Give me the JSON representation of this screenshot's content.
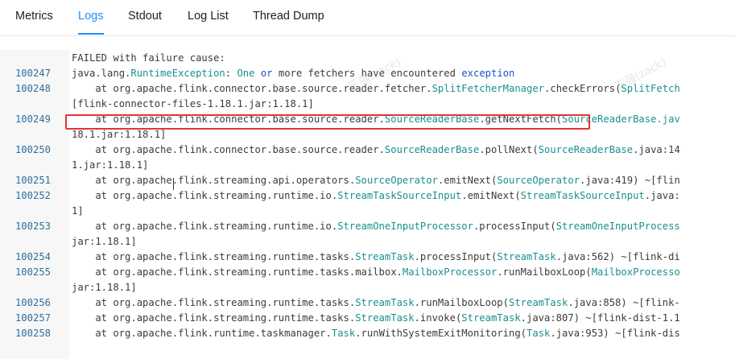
{
  "tabs": [
    {
      "label": "Metrics",
      "active": false
    },
    {
      "label": "Logs",
      "active": true
    },
    {
      "label": "Stdout",
      "active": false
    },
    {
      "label": "Log List",
      "active": false
    },
    {
      "label": "Thread Dump",
      "active": false
    }
  ],
  "colors": {
    "accent": "#1890ff",
    "highlight_border": "#e23434",
    "type_name": "#1a8f8f",
    "keyword": "#1a52c4",
    "line_number": "#2e6f9e"
  },
  "log": {
    "lines": [
      {
        "ln": "",
        "segs": [
          {
            "t": "FAILED with failure cause:",
            "c": ""
          }
        ]
      },
      {
        "ln": "100247",
        "segs": [
          {
            "t": "java.lang.",
            "c": ""
          },
          {
            "t": "RuntimeException",
            "c": "t1"
          },
          {
            "t": ": ",
            "c": ""
          },
          {
            "t": "One",
            "c": "t1"
          },
          {
            "t": " ",
            "c": ""
          },
          {
            "t": "or",
            "c": "t2"
          },
          {
            "t": " more fetchers have encountered ",
            "c": ""
          },
          {
            "t": "exception",
            "c": "t2"
          }
        ]
      },
      {
        "ln": "100248",
        "segs": [
          {
            "t": "    at org.apache.flink.connector.base.source.reader.fetcher.",
            "c": ""
          },
          {
            "t": "SplitFetcherManager",
            "c": "t1"
          },
          {
            "t": ".checkErrors(",
            "c": ""
          },
          {
            "t": "SplitFetch",
            "c": "t1"
          }
        ]
      },
      {
        "ln": "",
        "segs": [
          {
            "t": "[flink-connector-files-1.18.1.jar:1.18.1]",
            "c": ""
          }
        ]
      },
      {
        "ln": "100249",
        "segs": [
          {
            "t": "    at org.apache.flink.connector.base.source.reader.",
            "c": ""
          },
          {
            "t": "SourceReaderBase",
            "c": "t1"
          },
          {
            "t": ".getNextFetch(",
            "c": ""
          },
          {
            "t": "SourceReaderBase.jav",
            "c": "t1"
          }
        ]
      },
      {
        "ln": "",
        "segs": [
          {
            "t": "18.1.jar:1.18.1]",
            "c": ""
          }
        ]
      },
      {
        "ln": "100250",
        "segs": [
          {
            "t": "    at org.apache.flink.connector.base.source.reader.",
            "c": ""
          },
          {
            "t": "SourceReaderBase",
            "c": "t1"
          },
          {
            "t": ".pollNext(",
            "c": ""
          },
          {
            "t": "SourceReaderBase",
            "c": "t1"
          },
          {
            "t": ".java:14",
            "c": ""
          }
        ]
      },
      {
        "ln": "",
        "segs": [
          {
            "t": "1.jar:1.18.1]",
            "c": ""
          }
        ]
      },
      {
        "ln": "100251",
        "segs": [
          {
            "t": "    at org.apache.flink.streaming.api.operators.",
            "c": ""
          },
          {
            "t": "SourceOperator",
            "c": "t1"
          },
          {
            "t": ".emitNext(",
            "c": ""
          },
          {
            "t": "SourceOperator",
            "c": "t1"
          },
          {
            "t": ".java:419) ~[flin",
            "c": ""
          }
        ]
      },
      {
        "ln": "100252",
        "segs": [
          {
            "t": "    at org.apache.flink.streaming.runtime.io.",
            "c": ""
          },
          {
            "t": "StreamTaskSourceInput",
            "c": "t1"
          },
          {
            "t": ".emitNext(",
            "c": ""
          },
          {
            "t": "StreamTaskSourceInput",
            "c": "t1"
          },
          {
            "t": ".java:",
            "c": ""
          }
        ]
      },
      {
        "ln": "",
        "segs": [
          {
            "t": "1]",
            "c": ""
          }
        ]
      },
      {
        "ln": "100253",
        "segs": [
          {
            "t": "    at org.apache.flink.streaming.runtime.io.",
            "c": ""
          },
          {
            "t": "StreamOneInputProcessor",
            "c": "t1"
          },
          {
            "t": ".processInput(",
            "c": ""
          },
          {
            "t": "StreamOneInputProcess",
            "c": "t1"
          }
        ]
      },
      {
        "ln": "",
        "segs": [
          {
            "t": "jar:1.18.1]",
            "c": ""
          }
        ]
      },
      {
        "ln": "100254",
        "segs": [
          {
            "t": "    at org.apache.flink.streaming.runtime.tasks.",
            "c": ""
          },
          {
            "t": "StreamTask",
            "c": "t1"
          },
          {
            "t": ".processInput(",
            "c": ""
          },
          {
            "t": "StreamTask",
            "c": "t1"
          },
          {
            "t": ".java:562) ~[flink-di",
            "c": ""
          }
        ]
      },
      {
        "ln": "100255",
        "segs": [
          {
            "t": "    at org.apache.flink.streaming.runtime.tasks.mailbox.",
            "c": ""
          },
          {
            "t": "MailboxProcessor",
            "c": "t1"
          },
          {
            "t": ".runMailboxLoop(",
            "c": ""
          },
          {
            "t": "MailboxProcesso",
            "c": "t1"
          }
        ]
      },
      {
        "ln": "",
        "segs": [
          {
            "t": "jar:1.18.1]",
            "c": ""
          }
        ]
      },
      {
        "ln": "100256",
        "segs": [
          {
            "t": "    at org.apache.flink.streaming.runtime.tasks.",
            "c": ""
          },
          {
            "t": "StreamTask",
            "c": "t1"
          },
          {
            "t": ".runMailboxLoop(",
            "c": ""
          },
          {
            "t": "StreamTask",
            "c": "t1"
          },
          {
            "t": ".java:858) ~[flink-",
            "c": ""
          }
        ]
      },
      {
        "ln": "100257",
        "segs": [
          {
            "t": "    at org.apache.flink.streaming.runtime.tasks.",
            "c": ""
          },
          {
            "t": "StreamTask",
            "c": "t1"
          },
          {
            "t": ".invoke(",
            "c": ""
          },
          {
            "t": "StreamTask",
            "c": "t1"
          },
          {
            "t": ".java:807) ~[flink-dist-1.1",
            "c": ""
          }
        ]
      },
      {
        "ln": "100258",
        "segs": [
          {
            "t": "    at org.apache.flink.runtime.taskmanager.",
            "c": ""
          },
          {
            "t": "Task",
            "c": "t1"
          },
          {
            "t": ".runWithSystemExitMonitoring(",
            "c": ""
          },
          {
            "t": "Task",
            "c": "t1"
          },
          {
            "t": ".java:953) ~[flink-dis",
            "c": ""
          }
        ]
      }
    ]
  }
}
